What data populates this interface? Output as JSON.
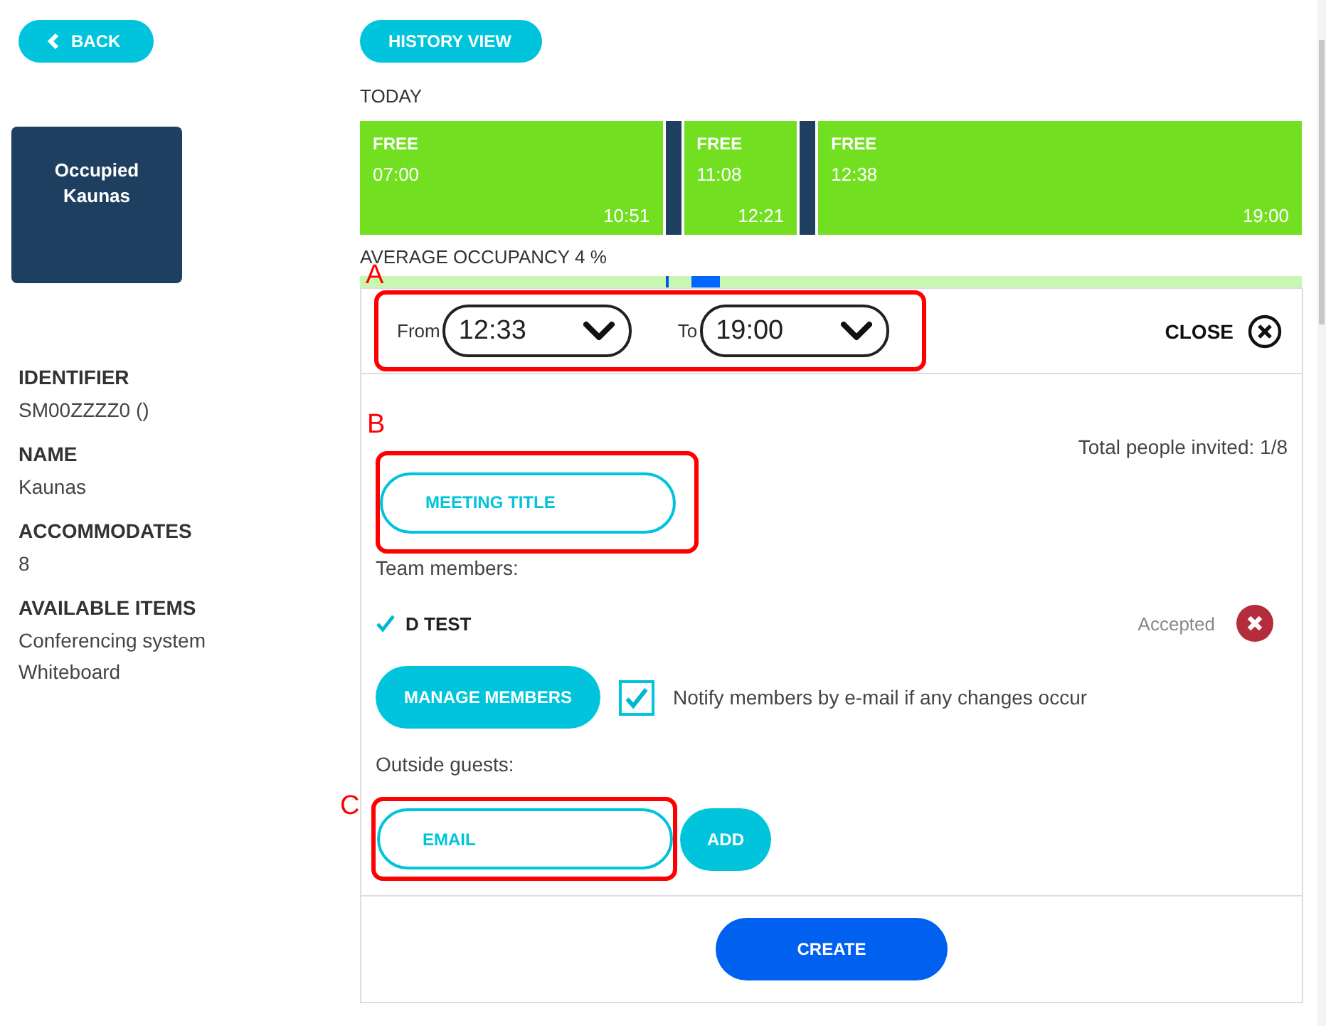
{
  "back_button": "BACK",
  "history_button": "HISTORY VIEW",
  "room": {
    "status": "Occupied",
    "name": "Kaunas"
  },
  "details": [
    {
      "label": "IDENTIFIER",
      "values": [
        "SM00ZZZZ0 ()"
      ]
    },
    {
      "label": "NAME",
      "values": [
        "Kaunas"
      ]
    },
    {
      "label": "ACCOMMODATES",
      "values": [
        "8"
      ]
    },
    {
      "label": "AVAILABLE ITEMS",
      "values": [
        "Conferencing system",
        "Whiteboard"
      ]
    }
  ],
  "timeline": {
    "title": "TODAY",
    "segments": [
      {
        "kind": "free",
        "label": "FREE",
        "start": "07:00",
        "end": "10:51"
      },
      {
        "kind": "occupied"
      },
      {
        "kind": "free",
        "label": "FREE",
        "start": "11:08",
        "end": "12:21"
      },
      {
        "kind": "occupied"
      },
      {
        "kind": "free",
        "label": "FREE",
        "start": "12:38",
        "end": "19:00"
      }
    ]
  },
  "occupancy": {
    "label": "AVERAGE OCCUPANCY 4 %"
  },
  "booking": {
    "from_label": "From",
    "from": "12:33",
    "to_label": "To",
    "to": "19:00",
    "close": "CLOSE",
    "invited": "Total people invited: 1/8",
    "title_placeholder": "MEETING TITLE",
    "team_label": "Team members:",
    "members": [
      {
        "name": "D TEST",
        "confirmed": true,
        "status": "Accepted"
      }
    ],
    "manage": "MANAGE MEMBERS",
    "notify": {
      "label": "Notify members by e-mail if any changes occur",
      "checked": true
    },
    "guests_label": "Outside guests:",
    "email_placeholder": "EMAIL",
    "add": "ADD",
    "create": "CREATE"
  },
  "annotations": [
    "A",
    "B",
    "C"
  ]
}
